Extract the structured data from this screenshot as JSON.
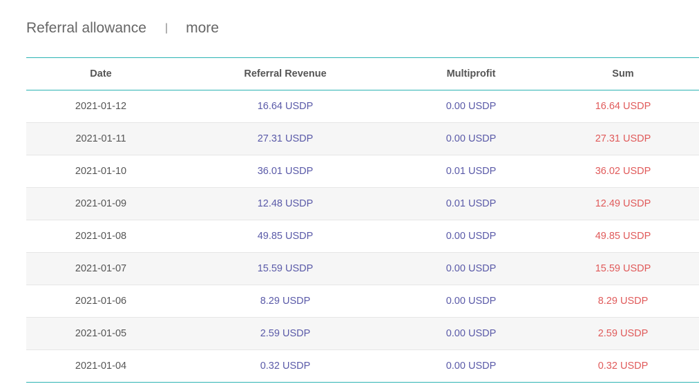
{
  "header": {
    "title": "Referral allowance",
    "separator": "|",
    "more_label": "more"
  },
  "table": {
    "columns": {
      "date": "Date",
      "referral_revenue": "Referral Revenue",
      "multiprofit": "Multiprofit",
      "sum": "Sum"
    },
    "rows": [
      {
        "date": "2021-01-12",
        "referral_revenue": "16.64 USDP",
        "multiprofit": "0.00 USDP",
        "sum": "16.64 USDP"
      },
      {
        "date": "2021-01-11",
        "referral_revenue": "27.31 USDP",
        "multiprofit": "0.00 USDP",
        "sum": "27.31 USDP"
      },
      {
        "date": "2021-01-10",
        "referral_revenue": "36.01 USDP",
        "multiprofit": "0.01 USDP",
        "sum": "36.02 USDP"
      },
      {
        "date": "2021-01-09",
        "referral_revenue": "12.48 USDP",
        "multiprofit": "0.01 USDP",
        "sum": "12.49 USDP"
      },
      {
        "date": "2021-01-08",
        "referral_revenue": "49.85 USDP",
        "multiprofit": "0.00 USDP",
        "sum": "49.85 USDP"
      },
      {
        "date": "2021-01-07",
        "referral_revenue": "15.59 USDP",
        "multiprofit": "0.00 USDP",
        "sum": "15.59 USDP"
      },
      {
        "date": "2021-01-06",
        "referral_revenue": "8.29 USDP",
        "multiprofit": "0.00 USDP",
        "sum": "8.29 USDP"
      },
      {
        "date": "2021-01-05",
        "referral_revenue": "2.59 USDP",
        "multiprofit": "0.00 USDP",
        "sum": "2.59 USDP"
      },
      {
        "date": "2021-01-04",
        "referral_revenue": "0.32 USDP",
        "multiprofit": "0.00 USDP",
        "sum": "0.32 USDP"
      }
    ]
  },
  "colors": {
    "accent_border": "#2bb3b3",
    "revenue_text": "#5a5aa8",
    "sum_text": "#e05a5a",
    "zebra_row": "#f6f6f6"
  }
}
